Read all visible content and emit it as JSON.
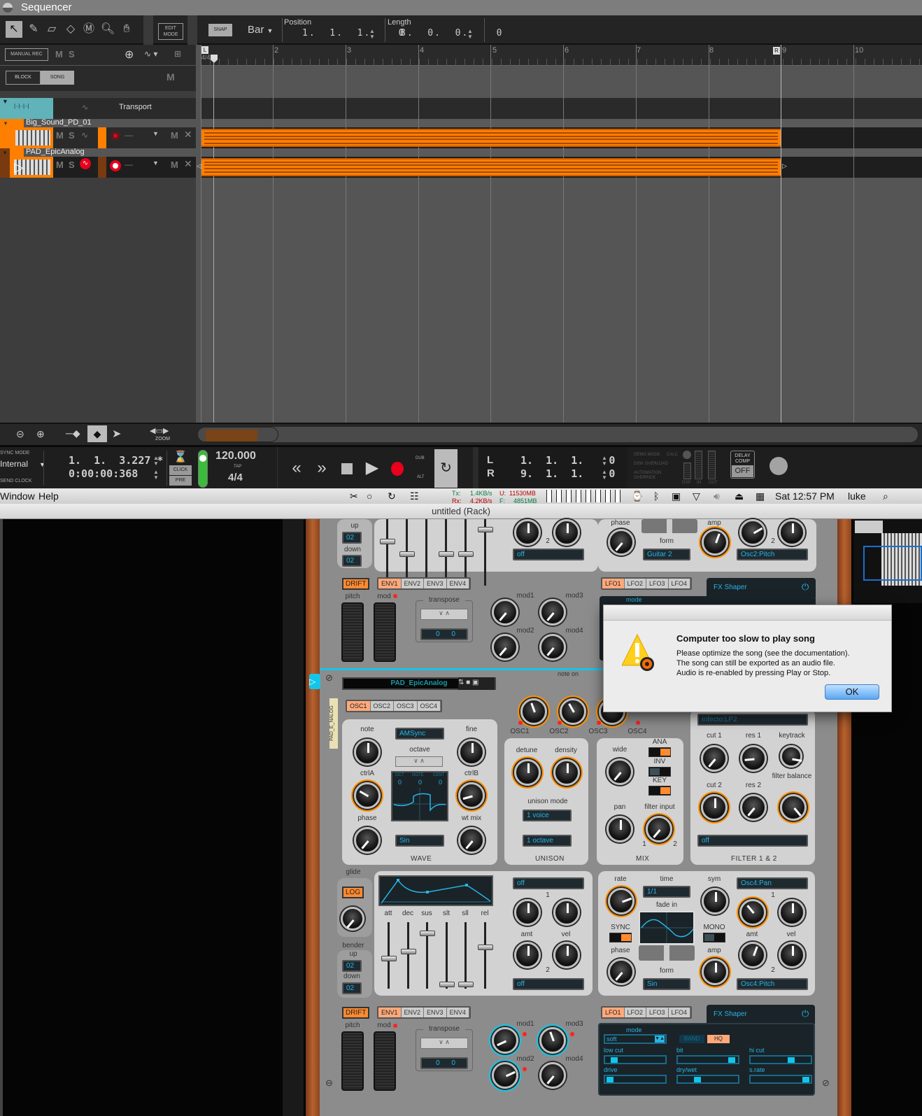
{
  "sequencer": {
    "title": "Sequencer",
    "tools": [
      "arrow-tool",
      "pencil-tool",
      "eraser-tool",
      "razor-tool",
      "mute-tool",
      "magnify-tool",
      "hand-tool"
    ],
    "edit_mode_label": "EDIT MODE",
    "snap_label": "SNAP",
    "snap_value": "Bar",
    "position_label": "Position",
    "position_value": "1.  1.  1.    0",
    "length_label": "Length",
    "length_value": "8.  0.  0.    0",
    "manual_rec_label": "MANUAL REC",
    "mute_label": "M",
    "solo_label": "S",
    "block_label": "BLOCK",
    "song_label": "SONG",
    "ruler": {
      "time_signature": "4/4",
      "left_locator": "L",
      "right_locator": "R",
      "bars": [
        "2",
        "3",
        "4",
        "5",
        "6",
        "7",
        "8",
        "9",
        "10"
      ]
    },
    "tracks": [
      {
        "name": "Transport",
        "type": "transport"
      },
      {
        "name": "Big_Sound_PD_01",
        "type": "instrument",
        "mute": "M",
        "solo": "S"
      },
      {
        "name": "PAD_EpicAnalog",
        "type": "instrument",
        "mute": "M",
        "solo": "S"
      }
    ],
    "zoom_label": "ZOOM"
  },
  "transport": {
    "sync_mode_label": "SYNC MODE",
    "sync_mode_value": "Internal",
    "clock_label": "SEND CLOCK",
    "song_position": "1.  1.  3.227 *",
    "song_time": "0:00:00:368",
    "click_label": "CLICK",
    "pre_label": "PRE",
    "tempo": "120.000",
    "tap_label": "TAP",
    "time_signature": "4/4",
    "dub_label": "DUB",
    "alt_label": "ALT",
    "loop_left_label": "L",
    "loop_left_value": "1.  1.  1.    0",
    "loop_right_label": "R",
    "loop_right_value": "9.  1.  1.    0",
    "demo_mode_label": "DEMO MODE",
    "disk_overload_label": "DISK OVERLOAD",
    "automation_override_label": "AUTOMATION OVERRIDE",
    "calc_label": "CALC",
    "dsp_label": "DSP",
    "in_label": "IN",
    "out_label": "OUT",
    "delay_comp_label": "DELAY COMP",
    "delay_comp_value": "OFF"
  },
  "menubar": {
    "items": [
      "Window",
      "Help"
    ],
    "tx_label": "Tx:",
    "tx_value": "1.4KB/s",
    "rx_label": "Rx:",
    "rx_value": "4.2KB/s",
    "used_label": "U:",
    "used_value": "11530MB",
    "free_label": "F:",
    "free_value": "4851MB",
    "clock": "Sat 12:57 PM",
    "user": "luke"
  },
  "rack": {
    "window_title": "untitled (Rack)",
    "upper": {
      "bender_up": "02",
      "bender_down": "02",
      "up_label": "up",
      "down_label": "down",
      "lcd_mod_off": "off",
      "lfo_form_label": "form",
      "lfo_form_value": "Guitar 2",
      "phase_label": "phase",
      "amp_label": "amp",
      "mod_dest": "Osc2:Pitch",
      "mod_slot_2": "2",
      "drift_label": "DRIFT",
      "env_tabs": [
        "ENV1",
        "ENV2",
        "ENV3",
        "ENV4"
      ],
      "lfo_tabs": [
        "LFO1",
        "LFO2",
        "LFO3",
        "LFO4"
      ],
      "fx_title": "FX Shaper",
      "fx_mode_label": "mode",
      "pitch_label": "pitch",
      "mod_label": "mod",
      "transpose_label": "transpose",
      "transpose_values": [
        "0",
        "0"
      ],
      "mod_knobs": [
        "mod1",
        "mod2",
        "mod3",
        "mod4"
      ]
    },
    "synth": {
      "patch_name": "PAD_EpicAnalog",
      "device_label": "PAD_E_NALOG",
      "note_on_label": "note on",
      "osc_tabs": [
        "OSC1",
        "OSC2",
        "OSC3",
        "OSC4"
      ],
      "osc_level_labels": [
        "OSC1",
        "OSC2",
        "OSC3",
        "OSC4"
      ],
      "note_label": "note",
      "fine_label": "fine",
      "wave_value": "AMSync",
      "octave_label": "octave",
      "ctrlA_label": "ctrlA",
      "ctrlB_label": "ctrlB",
      "display_headers": [
        "OCT",
        "NOTE",
        "CENT"
      ],
      "display_values": [
        "0",
        "0",
        "0"
      ],
      "phase_label": "phase",
      "wt_mix_label": "wt mix",
      "phase_wave_value": "Sin",
      "wave_section_label": "WAVE",
      "detune_label": "detune",
      "density_label": "density",
      "unison_mode_label": "unison mode",
      "unison_voices": "1 voice",
      "unison_octave": "1 octave",
      "unison_section_label": "UNISON",
      "wide_label": "wide",
      "ana_label": "ANA",
      "inv_label": "INV",
      "key_label": "KEY",
      "pan_label": "pan",
      "filter_input_label": "filter input",
      "filter_input_1": "1",
      "filter_input_2": "2",
      "mix_section_label": "MIX",
      "filter_type": "Infecto:LP2",
      "cut1_label": "cut 1",
      "res1_label": "res 1",
      "keytrack_label": "keytrack",
      "cut2_label": "cut 2",
      "res2_label": "res 2",
      "filter_balance_label": "filter balance",
      "filter_mod": "off",
      "filter_section_label": "FILTER 1 & 2",
      "glide_label": "glide",
      "log_label": "LOG",
      "bender_label": "bender",
      "bender_up": "02",
      "bender_down": "02",
      "up_label": "up",
      "down_label": "down",
      "env_labels": [
        "att",
        "dec",
        "sus",
        "slt",
        "sll",
        "rel"
      ],
      "env_mod_1": "off",
      "env_mod_2": "off",
      "amt_label": "amt",
      "vel_label": "vel",
      "slot_1": "1",
      "slot_2": "2",
      "lfo_rate_label": "rate",
      "lfo_time_label": "time",
      "lfo_time_value": "1/1",
      "lfo_sym_label": "sym",
      "lfo_fade_label": "fade in",
      "lfo_sync_label": "SYNC",
      "lfo_mono_label": "MONO",
      "lfo_phase_label": "phase",
      "lfo_amp_label": "amp",
      "lfo_form_label": "form",
      "lfo_form_value": "Sin",
      "lfo_mod_1": "Osc4:Pan",
      "lfo_mod_2": "Osc4:Pitch",
      "drift_label": "DRIFT",
      "env_tabs": [
        "ENV1",
        "ENV2",
        "ENV3",
        "ENV4"
      ],
      "lfo_tabs": [
        "LFO1",
        "LFO2",
        "LFO3",
        "LFO4"
      ],
      "pitch_label": "pitch",
      "mod_label": "mod",
      "transpose_label": "transpose",
      "transpose_values": [
        "0",
        "0"
      ],
      "mod_knobs": [
        "mod1",
        "mod2",
        "mod3",
        "mod4"
      ],
      "fx": {
        "title": "FX Shaper",
        "mode_label": "mode",
        "mode_value": "soft",
        "band_label": "BAND",
        "hq_label": "HQ",
        "sliders": [
          {
            "label": "low cut",
            "value": 0.1
          },
          {
            "label": "bit",
            "value": 0.95
          },
          {
            "label": "hi cut",
            "value": 0.7
          },
          {
            "label": "drive",
            "value": 0.03
          },
          {
            "label": "dry/wet",
            "value": 0.3
          },
          {
            "label": "s.rate",
            "value": 0.97
          }
        ]
      }
    }
  },
  "dialog": {
    "title": "Computer too slow to play song",
    "lines": [
      "Please optimize the song (see the documentation).",
      "The song can still be exported as an audio file.",
      "Audio is re-enabled by pressing Play or Stop."
    ],
    "ok_label": "OK"
  },
  "colors": {
    "clip_orange": "#ff7f00",
    "lcd_cyan": "#27b4e6",
    "transport_track": "#5fb3b9",
    "record_red": "#e8001c"
  }
}
